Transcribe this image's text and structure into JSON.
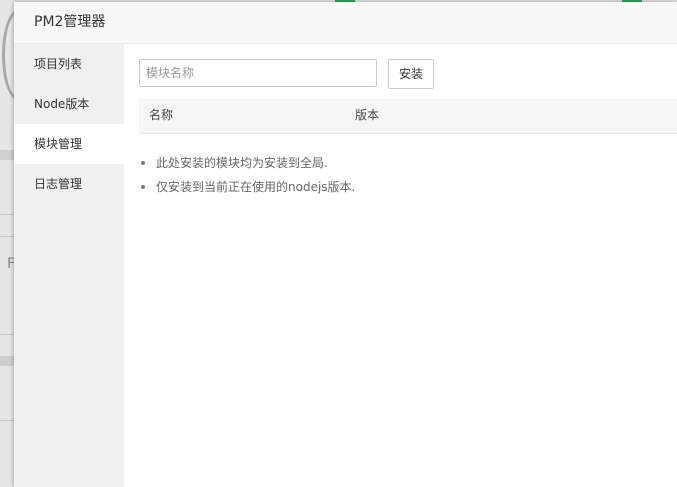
{
  "modal": {
    "title": "PM2管理器"
  },
  "sidebar": {
    "items": [
      {
        "label": "项目列表",
        "active": false
      },
      {
        "label": "Node版本",
        "active": false
      },
      {
        "label": "模块管理",
        "active": true
      },
      {
        "label": "日志管理",
        "active": false
      }
    ]
  },
  "toolbar": {
    "search_placeholder": "模块名称",
    "install_label": "安装"
  },
  "table": {
    "columns": [
      "名称",
      "版本"
    ]
  },
  "notes": [
    "此处安装的模块均为安装到全局.",
    "仅安装到当前正在使用的nodejs版本."
  ],
  "background": {
    "partial_letter": "F"
  },
  "colors": {
    "accent_green": "#3e9a54"
  }
}
